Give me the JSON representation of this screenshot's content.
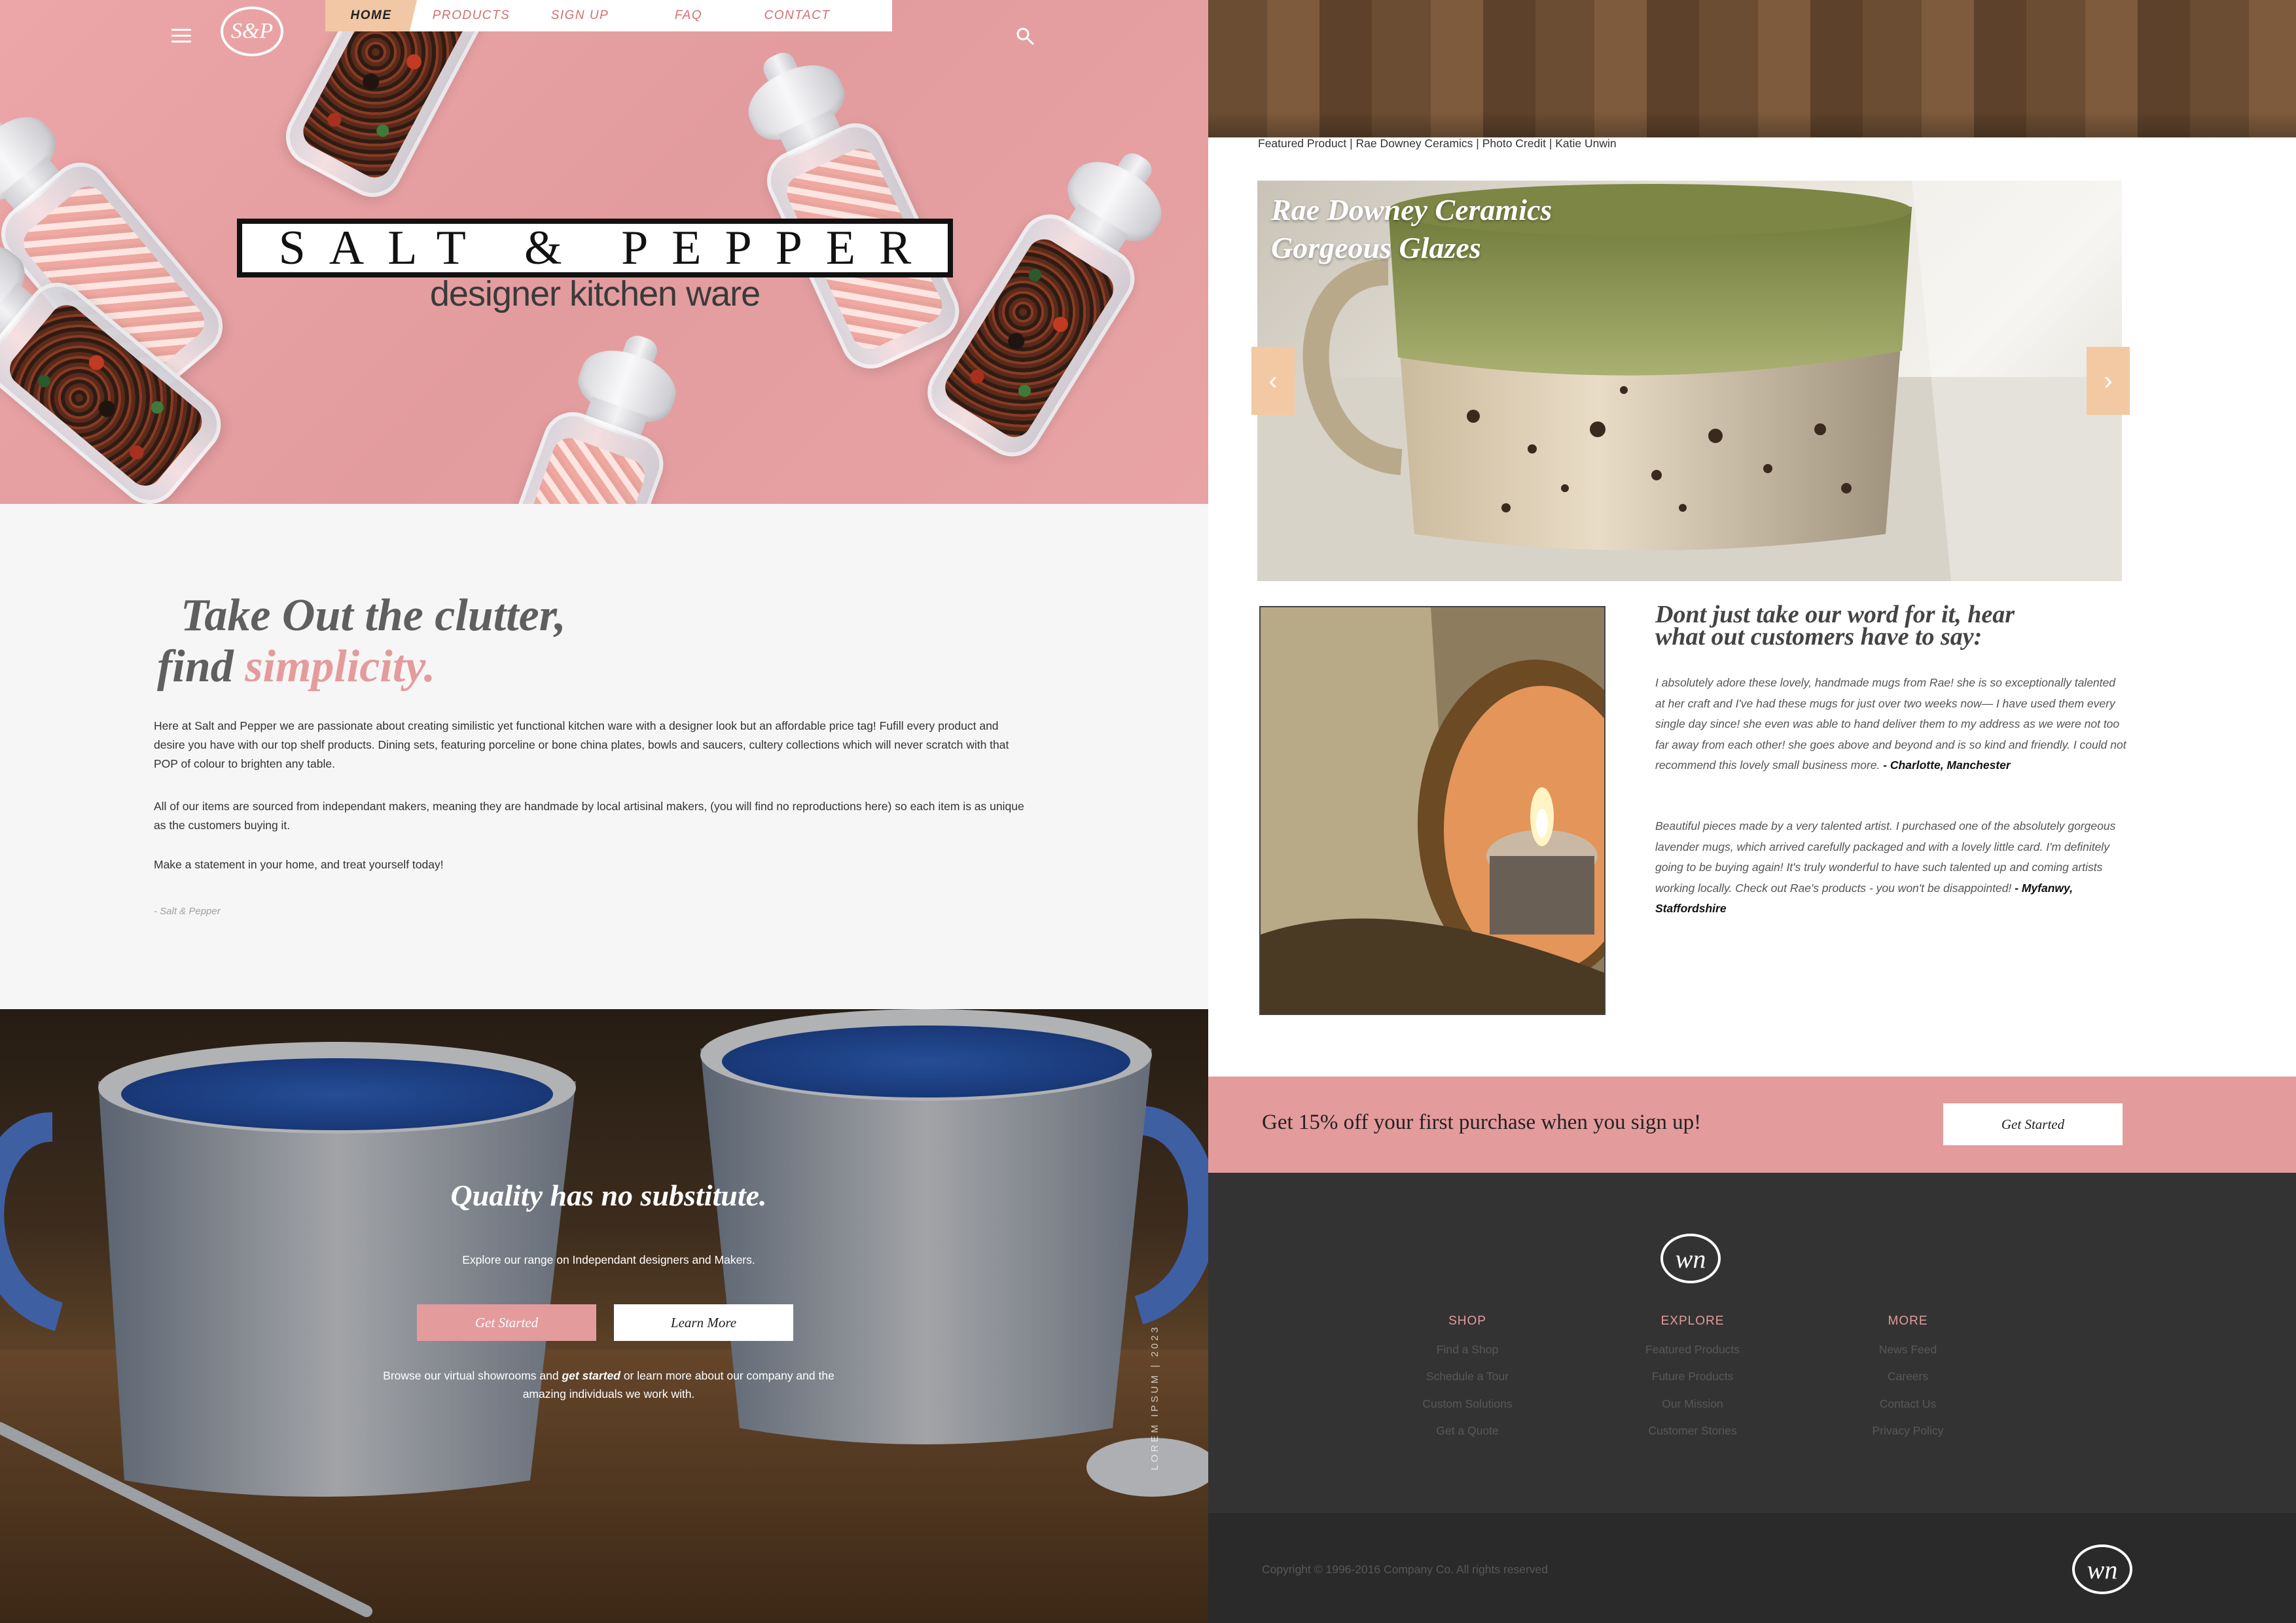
{
  "nav": {
    "tabs": [
      {
        "label": "HOME",
        "active": true
      },
      {
        "label": "PRODUCTS"
      },
      {
        "label": "SIGN UP"
      },
      {
        "label": "FAQ"
      },
      {
        "label": "CONTACT"
      }
    ],
    "logo_text": "S&P",
    "icons": {
      "menu": "hamburger-menu-icon",
      "search": "search-icon"
    }
  },
  "hero": {
    "brand": "SALT & PEPPER",
    "tagline": "designer kitchen ware"
  },
  "intro": {
    "heading_line1": "Take Out the clutter,",
    "heading_line2_prefix": "find ",
    "heading_line2_accent": "simplicity.",
    "paragraphs": [
      "Here at Salt and Pepper we are passionate about creating similistic yet functional kitchen ware with a designer look but an affordable price tag! Fufill every product and desire you have with our top shelf products. Dining sets, featuring porceline or bone china plates, bowls and saucers, cultery collections which will never scratch with that POP of colour to brighten any table.",
      "All of our items are sourced from independant makers, meaning they are handmade by local artisinal makers, (you will find no reproductions here) so each item is as unique as the customers buying it.",
      "Make a  statement in your home, and treat yourself today!"
    ],
    "signature": "- Salt & Pepper"
  },
  "quality": {
    "title": "Quality has no substitute.",
    "subtitle": "Explore our range on Independant designers and Makers.",
    "get_started": "Get Started",
    "learn_more": "Learn More",
    "browse_pre": "Browse our virtual showrooms and ",
    "browse_em": "get started",
    "browse_post": " or learn more about our company and the amazing individuals we work with.",
    "vertical_text": "LOREM IPSUM | 2023"
  },
  "featured": {
    "caption": "Featured Product | Rae Downey Ceramics | Photo Credit | Katie Unwin",
    "title_line1": "Rae Downey Ceramics",
    "title_line2": "Gorgeous Glazes",
    "prev_icon": "chevron-left-icon",
    "next_icon": "chevron-right-icon"
  },
  "testimonials": {
    "heading_line1": "Dont just take our word for it, hear",
    "heading_line2": "what out customers have to say:",
    "quotes": [
      {
        "text": "I absolutely adore these lovely, handmade mugs from Rae! she is so exceptionally talented at her craft and I've had these mugs for just over two weeks now— I have used them every single day since! she even was able to hand deliver them to my address as we were not too far away from each other! she goes above and beyond and is so kind and friendly. I could not recommend this lovely small business more.  ",
        "author": "- Charlotte, Manchester"
      },
      {
        "text": "Beautiful pieces made by a very talented artist. I purchased one of the absolutely gorgeous lavender mugs, which arrived carefully packaged and with a lovely little card. I'm definitely going to be buying again! It's truly wonderful to have such talented up and coming artists working locally. Check out Rae's products - you won't be disappointed! ",
        "author": "- Myfanwy, Staffordshire"
      }
    ]
  },
  "promo": {
    "text": "Get 15% off your first purchase when you sign up!",
    "button": "Get Started"
  },
  "footer": {
    "logo_text": "wn",
    "columns": [
      {
        "heading": "SHOP",
        "links": [
          "Find a Shop",
          "Schedule a Tour",
          "Custom Solutions",
          "Get a Quote"
        ]
      },
      {
        "heading": "EXPLORE",
        "links": [
          "Featured Products",
          "Future Products",
          "Our Mission",
          "Customer Stories"
        ]
      },
      {
        "heading": "MORE",
        "links": [
          "News Feed",
          "Careers",
          "Contact Us",
          "Privacy Policy"
        ]
      }
    ],
    "copyright": "Copyright © 1996-2016 Company Co. All rights reserved"
  },
  "colors": {
    "pink": "#e49b9c",
    "peach": "#f1c7a5",
    "dark": "#333333"
  }
}
